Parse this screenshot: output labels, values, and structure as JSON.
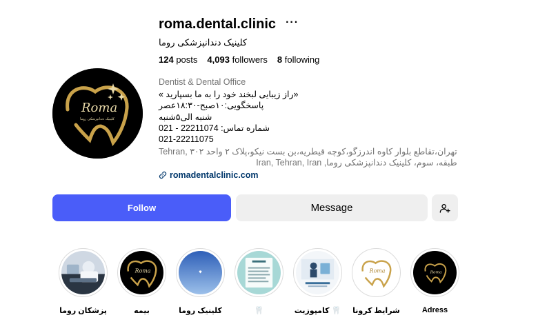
{
  "profile": {
    "username": "roma.dental.clinic",
    "more_glyph": "···",
    "full_name": "کلینیک دندانپزشکی روما",
    "avatar_logo_text": "Roma",
    "avatar_sub_text": "کلینیک دندانپزشکی روما",
    "stats": {
      "posts_count": "124",
      "posts_label": "posts",
      "followers_count": "4,093",
      "followers_label": "followers",
      "following_count": "8",
      "following_label": "following"
    },
    "category": "Dentist & Dental Office",
    "bio_lines": [
      "«راز زیبایی لبخند خود را به ما بسپارید »",
      "پاسخگویی:۱۰صبح-۱۸:۳۰عصر",
      "شنبه الی۵شنبه",
      "شماره تماس: 22211074 - 021",
      "021-22211075"
    ],
    "address_lines": [
      "تهران،تقاطع بلوار کاوه اندرزگو،کوچه قیطریه،بن بست نیکو،پلاک ۲ واحد ۳۰۲ ,Tehran",
      "طبقه، سوم، کلینیک دندانپزشکی روما, Iran, Tehran, Iran"
    ],
    "website": "romadentalclinic.com",
    "icons": {
      "link": "link-icon",
      "suggest": "add-person-icon"
    }
  },
  "actions": {
    "follow_label": "Follow",
    "message_label": "Message"
  },
  "highlights": [
    {
      "label": "Adress",
      "style": "logo-dark"
    },
    {
      "label": "شرایط کرونا",
      "style": "logo-light"
    },
    {
      "label": "کامپوزیت 🦷",
      "style": "infographic"
    },
    {
      "label": "🦷",
      "style": "teal-card"
    },
    {
      "label": "کلینیک روما",
      "style": "blue-gradient"
    },
    {
      "label": "بیمه",
      "style": "logo-dark"
    },
    {
      "label": "پزشکان روما",
      "style": "photo"
    }
  ],
  "colors": {
    "follow_bg": "#4a5df9",
    "message_bg": "#efefef",
    "gold": "#c9a24a",
    "link": "#00376b",
    "muted": "#737373"
  }
}
